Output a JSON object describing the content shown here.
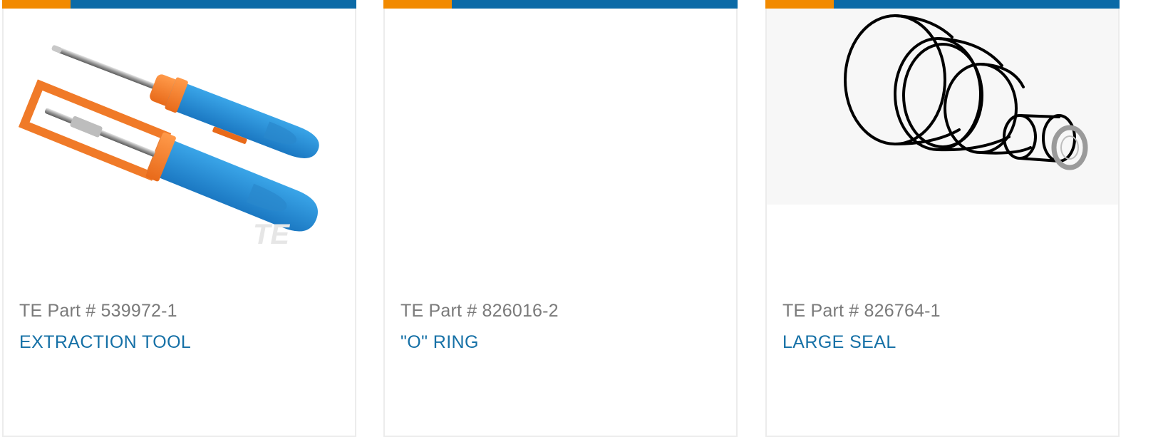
{
  "colors": {
    "accent_orange": "#f28a00",
    "brand_blue": "#0b6aa7",
    "link_blue": "#1570a6",
    "part_number_gray": "#7a7a7a",
    "card_border": "#ececec"
  },
  "products": [
    {
      "part_number_text": "TE Part # 539972-1",
      "name": "EXTRACTION TOOL",
      "image_icon": "extraction-tool-image",
      "watermark": "TE"
    },
    {
      "part_number_text": "TE Part # 826016-2",
      "name": "\"O\" RING",
      "image_icon": "no-image-placeholder"
    },
    {
      "part_number_text": "TE Part # 826764-1",
      "name": "LARGE SEAL",
      "image_icon": "large-seal-drawing"
    }
  ]
}
